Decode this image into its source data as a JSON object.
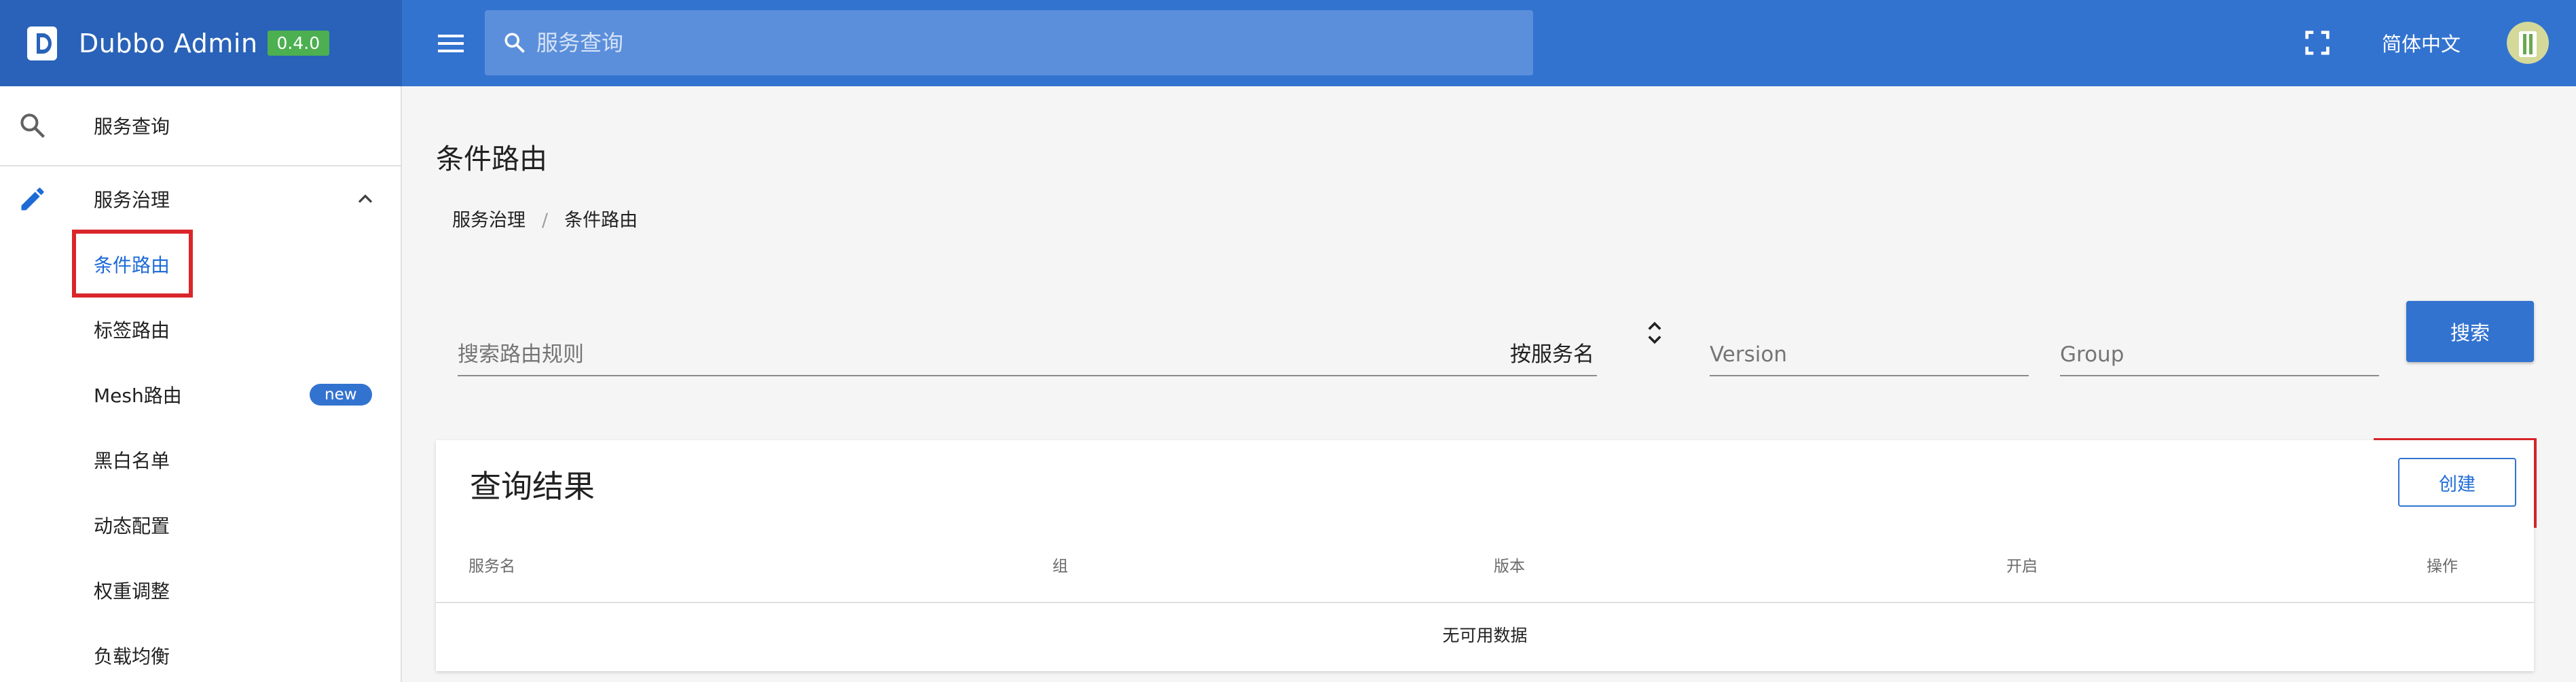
{
  "header": {
    "title": "Dubbo Admin",
    "version": "0.4.0",
    "search_placeholder": "服务查询",
    "language": "简体中文"
  },
  "sidebar": {
    "items": [
      {
        "label": "服务查询",
        "icon": "search-icon"
      },
      {
        "label": "服务治理",
        "icon": "pencil-icon",
        "expanded": true
      }
    ],
    "sub_items": [
      {
        "label": "条件路由",
        "active": true
      },
      {
        "label": "标签路由"
      },
      {
        "label": "Mesh路由",
        "badge": "new"
      },
      {
        "label": "黑白名单"
      },
      {
        "label": "动态配置"
      },
      {
        "label": "权重调整"
      },
      {
        "label": "负载均衡"
      }
    ]
  },
  "page": {
    "title": "条件路由",
    "breadcrumb": [
      "服务治理",
      "条件路由"
    ]
  },
  "filters": {
    "rule_placeholder": "搜索路由规则",
    "select_value": "按服务名",
    "version_placeholder": "Version",
    "group_placeholder": "Group",
    "search_label": "搜索"
  },
  "results": {
    "title": "查询结果",
    "create_label": "创建",
    "columns": [
      "服务名",
      "组",
      "版本",
      "开启",
      "操作"
    ],
    "empty_text": "无可用数据"
  },
  "colors": {
    "primary": "#3373d0",
    "header_dark": "#2962b8",
    "badge_green": "#4caf50",
    "highlight_red": "#d9262a"
  }
}
